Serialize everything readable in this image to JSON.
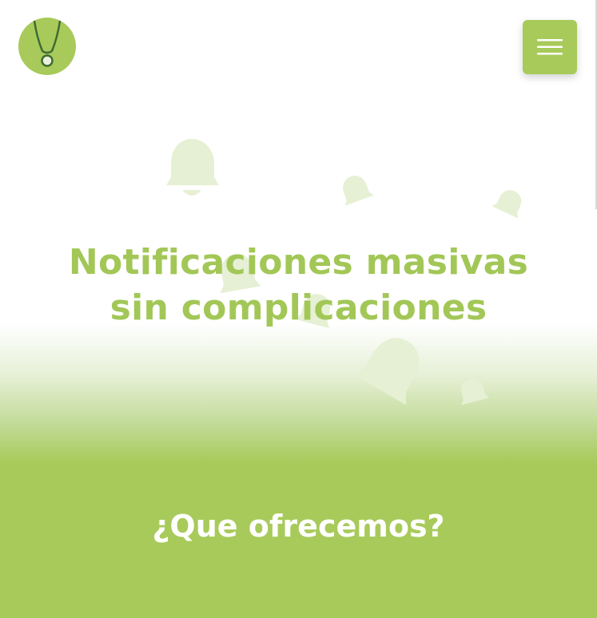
{
  "header": {
    "logo_icon": "exclamation-bell-logo-icon",
    "menu_icon": "hamburger-menu-icon"
  },
  "hero": {
    "title_line1": "Notificaciones masivas",
    "title_line2": "sin complicaciones"
  },
  "offer": {
    "title": "¿Que ofrecemos?"
  },
  "colors": {
    "brand_green": "#a8ca5a",
    "title_green": "#a2c757",
    "logo_ring": "#3f6b33",
    "bell_faded": "#e4efd2"
  }
}
